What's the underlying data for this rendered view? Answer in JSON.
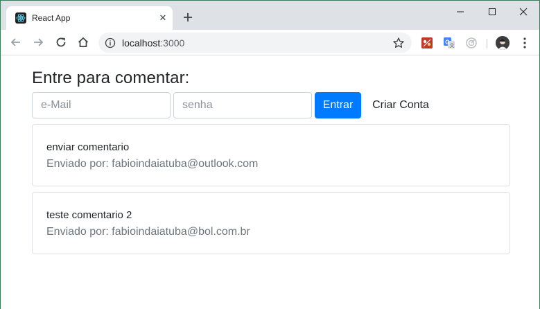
{
  "browser": {
    "tab_title": "React App",
    "url_host": "localhost",
    "url_port": ":3000"
  },
  "login": {
    "heading": "Entre para comentar:",
    "email_placeholder": "e-Mail",
    "password_placeholder": "senha",
    "submit_label": "Entrar",
    "signup_label": "Criar Conta"
  },
  "comments": [
    {
      "text": "enviar comentario",
      "meta": "Enviado por: fabioindaiatuba@outlook.com"
    },
    {
      "text": "teste comentario 2",
      "meta": "Enviado por: fabioindaiatuba@bol.com.br"
    }
  ],
  "colors": {
    "primary": "#007bff",
    "tabbar": "#dee1e6",
    "muted_text": "#6c757d"
  }
}
